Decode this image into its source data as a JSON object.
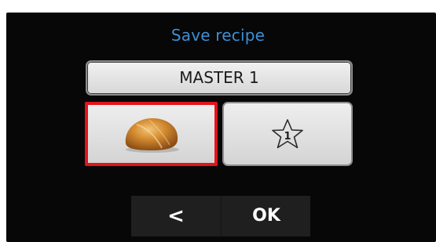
{
  "screen": {
    "title": "Save recipe",
    "recipe_name": "MASTER 1",
    "tiles": [
      {
        "kind": "image",
        "icon": "bread-roll-icon",
        "selected": true
      },
      {
        "kind": "favorite",
        "icon": "star-icon",
        "number": "1",
        "selected": false
      }
    ],
    "buttons": {
      "back_label": "<",
      "ok_label": "OK"
    },
    "colors": {
      "title": "#3d8fd6",
      "selection_border": "#e2141b",
      "background": "#070707",
      "tile": "#e0e0e0"
    }
  }
}
